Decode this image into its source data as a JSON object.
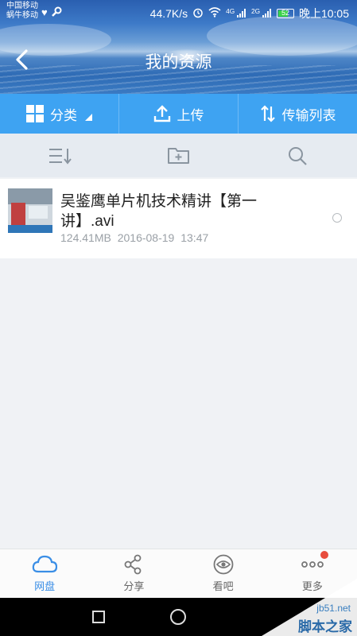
{
  "status": {
    "carrier_line1": "中国移动",
    "carrier_line2": "蜗牛移动",
    "speed": "44.7K/s",
    "net1": "4G",
    "net2": "2G",
    "battery": "52",
    "time": "晚上10:05"
  },
  "header": {
    "title": "我的资源",
    "back_icon": "chevron-left-icon"
  },
  "toolbar": {
    "category_label": "分类",
    "upload_label": "上传",
    "transfer_label": "传输列表"
  },
  "subbar": {
    "sort_icon": "sort-icon",
    "new_folder_icon": "new-folder-icon",
    "search_icon": "search-icon"
  },
  "files": [
    {
      "name": "吴鉴鹰单片机技术精讲【第一讲】.avi",
      "size": "124.41MB",
      "date": "2016-08-19",
      "time": "13:47"
    }
  ],
  "tabs": [
    {
      "label": "网盘",
      "icon": "cloud-icon",
      "active": true
    },
    {
      "label": "分享",
      "icon": "share-icon",
      "active": false
    },
    {
      "label": "看吧",
      "icon": "eye-icon",
      "active": false
    },
    {
      "label": "更多",
      "icon": "more-icon",
      "active": false,
      "badge": true
    }
  ],
  "watermark": {
    "url": "jb51.net",
    "text": "脚本之家"
  },
  "colors": {
    "accent": "#3ea3f2",
    "active_tab": "#3a8ee6",
    "badge": "#e84d3d"
  }
}
